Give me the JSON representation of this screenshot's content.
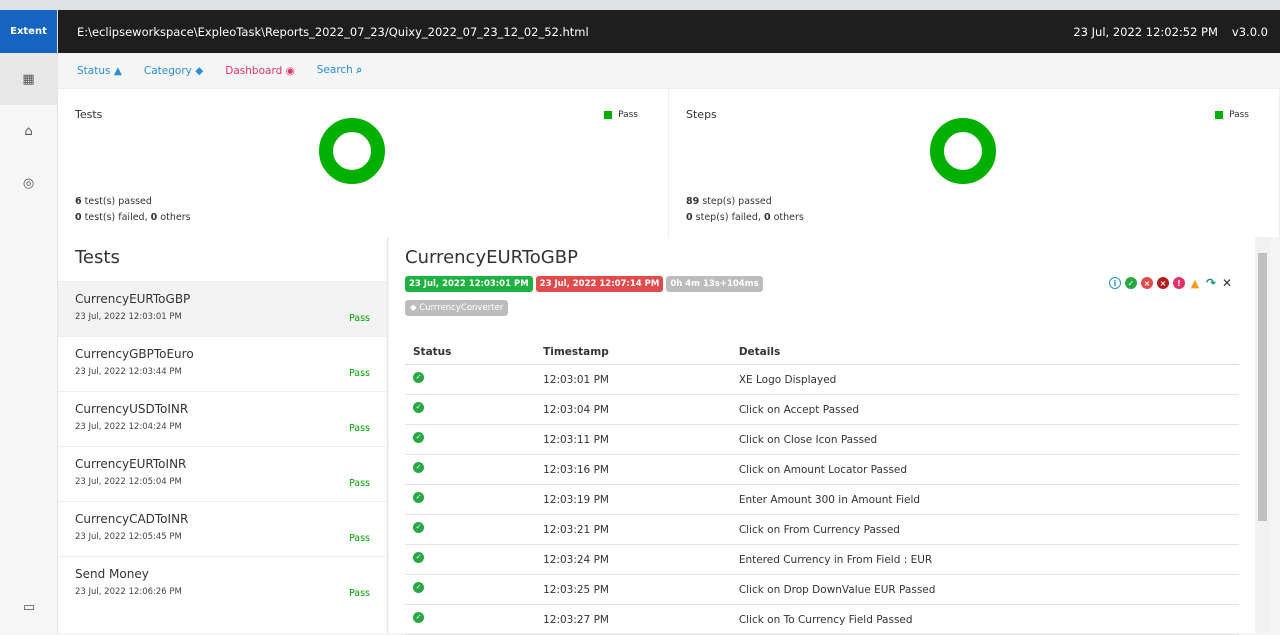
{
  "brand": "Extent",
  "header": {
    "path": "E:\\eclipseworkspace\\ExpleoTask\\Reports_2022_07_23/Quixy_2022_07_23_12_02_52.html",
    "datetime": "23 Jul, 2022 12:02:52 PM",
    "version": "v3.0.0"
  },
  "nav": {
    "status": "Status",
    "category": "Category",
    "dashboard": "Dashboard",
    "search": "Search"
  },
  "dashboard": {
    "tests": {
      "title": "Tests",
      "legend": "Pass",
      "passed_count": "6",
      "passed_text": " test(s) passed",
      "failed_count": "0",
      "failed_text": " test(s) failed, ",
      "others_count": "0",
      "others_text": " others"
    },
    "steps": {
      "title": "Steps",
      "legend": "Pass",
      "passed_count": "89",
      "passed_text": " step(s) passed",
      "failed_count": "0",
      "failed_text": " step(s) failed, ",
      "others_count": "0",
      "others_text": " others"
    }
  },
  "tests_heading": "Tests",
  "tests": [
    {
      "name": "CurrencyEURToGBP",
      "time": "23 Jul, 2022 12:03:01 PM",
      "status": "Pass"
    },
    {
      "name": "CurrencyGBPToEuro",
      "time": "23 Jul, 2022 12:03:44 PM",
      "status": "Pass"
    },
    {
      "name": "CurrencyUSDToINR",
      "time": "23 Jul, 2022 12:04:24 PM",
      "status": "Pass"
    },
    {
      "name": "CurrencyEURToINR",
      "time": "23 Jul, 2022 12:05:04 PM",
      "status": "Pass"
    },
    {
      "name": "CurrencyCADToINR",
      "time": "23 Jul, 2022 12:05:45 PM",
      "status": "Pass"
    },
    {
      "name": "Send Money",
      "time": "23 Jul, 2022 12:06:26 PM",
      "status": "Pass"
    }
  ],
  "detail": {
    "title": "CurrencyEURToGBP",
    "start": "23 Jul, 2022 12:03:01 PM",
    "end": "23 Jul, 2022 12:07:14 PM",
    "duration": "0h 4m 13s+104ms",
    "tag": "CurrrencyConverter",
    "columns": [
      "Status",
      "Timestamp",
      "Details"
    ],
    "rows": [
      {
        "time": "12:03:01 PM",
        "details": "XE Logo Displayed"
      },
      {
        "time": "12:03:04 PM",
        "details": "Click on Accept Passed"
      },
      {
        "time": "12:03:11 PM",
        "details": "Click on Close Icon Passed"
      },
      {
        "time": "12:03:16 PM",
        "details": "Click on Amount Locator Passed"
      },
      {
        "time": "12:03:19 PM",
        "details": "Enter Amount 300 in Amount Field"
      },
      {
        "time": "12:03:21 PM",
        "details": "Click on From Currency Passed"
      },
      {
        "time": "12:03:24 PM",
        "details": "Entered Currency in From Field : EUR"
      },
      {
        "time": "12:03:25 PM",
        "details": "Click on Drop DownValue EUR Passed"
      },
      {
        "time": "12:03:27 PM",
        "details": "Click on To Currency Field Passed"
      }
    ]
  },
  "colors": {
    "pass": "#00b000",
    "fail": "#e04b4b",
    "header": "#1e1e1e",
    "brand": "#1565c0"
  }
}
